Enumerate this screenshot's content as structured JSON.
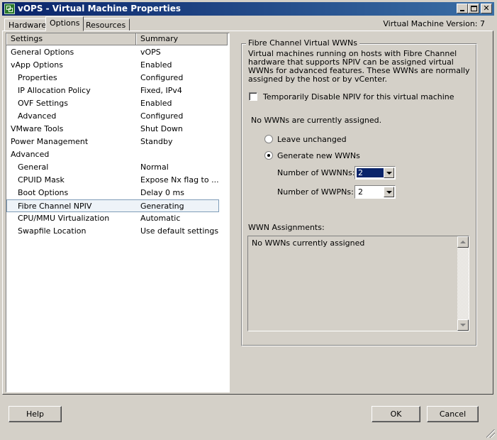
{
  "window": {
    "title": "vOPS - Virtual Machine Properties",
    "vm_version": "Virtual Machine Version: 7"
  },
  "tabs": [
    {
      "label": "Hardware"
    },
    {
      "label": "Options"
    },
    {
      "label": "Resources"
    }
  ],
  "list": {
    "header_settings": "Settings",
    "header_summary": "Summary",
    "rows": [
      {
        "setting": "General Options",
        "summary": "vOPS"
      },
      {
        "setting": "vApp Options",
        "summary": "Enabled"
      },
      {
        "setting": "Properties",
        "summary": "Configured"
      },
      {
        "setting": "IP Allocation Policy",
        "summary": "Fixed, IPv4"
      },
      {
        "setting": "OVF Settings",
        "summary": "Enabled"
      },
      {
        "setting": "Advanced",
        "summary": "Configured"
      },
      {
        "setting": "VMware Tools",
        "summary": "Shut Down"
      },
      {
        "setting": "Power Management",
        "summary": "Standby"
      },
      {
        "setting": "Advanced",
        "summary": ""
      },
      {
        "setting": "General",
        "summary": "Normal"
      },
      {
        "setting": "CPUID Mask",
        "summary": "Expose Nx flag to ..."
      },
      {
        "setting": "Boot Options",
        "summary": "Delay 0 ms"
      },
      {
        "setting": "Fibre Channel NPIV",
        "summary": "Generating"
      },
      {
        "setting": "CPU/MMU Virtualization",
        "summary": "Automatic"
      },
      {
        "setting": "Swapfile Location",
        "summary": "Use default settings"
      }
    ]
  },
  "fibre": {
    "group_title": "Fibre Channel Virtual WWNs",
    "description": "Virtual machines running on hosts with Fibre Channel hardware that supports NPIV can be assigned virtual WWNs for advanced features. These WWNs are normally assigned by the host or by vCenter.",
    "disable_npiv_label": "Temporarily Disable NPIV for this virtual machine",
    "no_wwns_text": "No WWNs are currently assigned.",
    "leave_unchanged_label": "Leave unchanged",
    "generate_new_label": "Generate new WWNs",
    "wwnns_label": "Number of WWNNs:",
    "wwnns_value": "2",
    "wwpns_label": "Number of WWPNs:",
    "wwpns_value": "2",
    "assignments_label": "WWN Assignments:",
    "assignments_text": "No WWNs currently assigned"
  },
  "buttons": {
    "help": "Help",
    "ok": "OK",
    "cancel": "Cancel"
  }
}
